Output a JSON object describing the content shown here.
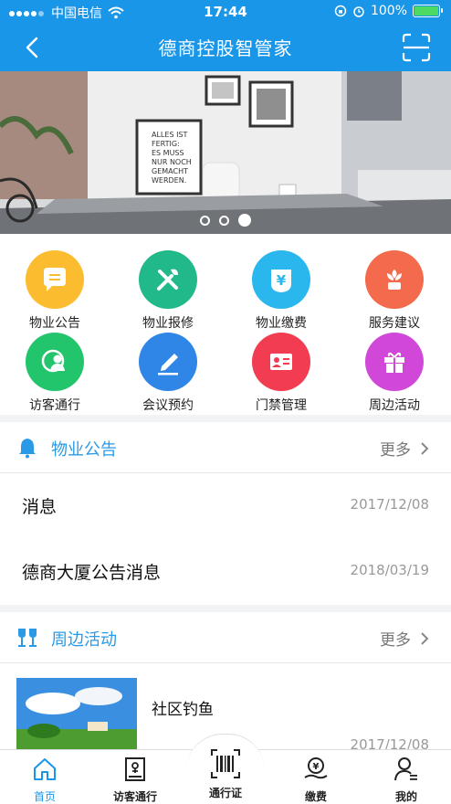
{
  "status_bar": {
    "carrier": "中国电信",
    "time": "17:44",
    "battery": "100%"
  },
  "nav": {
    "title": "德商控股智管家"
  },
  "banner": {
    "slides": 3,
    "active_slide": 3,
    "poster_lines": [
      "ALLES IST",
      "FERTIG:",
      "ES MUSS",
      "NUR NOCH",
      "GEMACHT",
      "WERDEN."
    ]
  },
  "services": [
    {
      "label": "物业公告",
      "icon": "notice-icon",
      "color": "#fbbd2f"
    },
    {
      "label": "物业报修",
      "icon": "repair-tools-icon",
      "color": "#22b98a"
    },
    {
      "label": "物业缴费",
      "icon": "payment-yen-icon",
      "color": "#2ab7ee"
    },
    {
      "label": "服务建议",
      "icon": "flower-icon",
      "color": "#f46a4c"
    },
    {
      "label": "访客通行",
      "icon": "visitor-icon",
      "color": "#22c56b"
    },
    {
      "label": "会议预约",
      "icon": "pen-icon",
      "color": "#2f86e6"
    },
    {
      "label": "门禁管理",
      "icon": "id-card-icon",
      "color": "#f23c52"
    },
    {
      "label": "周边活动",
      "icon": "gift-icon",
      "color": "#d148d9"
    }
  ],
  "notices": {
    "title": "物业公告",
    "more": "更多",
    "items": [
      {
        "title": "消息",
        "date": "2017/12/08"
      },
      {
        "title": "德商大厦公告消息",
        "date": "2018/03/19"
      }
    ]
  },
  "activities": {
    "title": "周边活动",
    "more": "更多",
    "items": [
      {
        "title": "社区钓鱼",
        "date": "2017/12/08"
      }
    ]
  },
  "tabbar": {
    "tabs": [
      {
        "label": "首页",
        "icon": "home-icon",
        "active": true
      },
      {
        "label": "访客通行",
        "icon": "visitor-card-icon",
        "active": false
      },
      {
        "label": "通行证",
        "icon": "barcode-icon",
        "active": false
      },
      {
        "label": "缴费",
        "icon": "payment-hand-icon",
        "active": false
      },
      {
        "label": "我的",
        "icon": "profile-icon",
        "active": false
      }
    ]
  },
  "colors": {
    "brand": "#1a96e8",
    "accent_text": "#2a9ae6"
  }
}
